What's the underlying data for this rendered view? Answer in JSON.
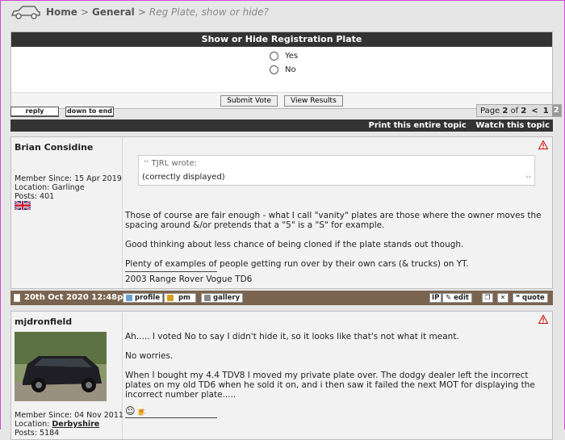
{
  "breadcrumb": {
    "home": "Home",
    "sep1": ">",
    "general": "General",
    "sep2": ">",
    "current": "Reg Plate, show or hide?"
  },
  "poll": {
    "title": "Show or Hide Registration Plate",
    "options": [
      "Yes",
      "No"
    ],
    "submit": "Submit Vote",
    "results": "View Results"
  },
  "topic_buttons": {
    "reply": "reply",
    "down": "down to end"
  },
  "pager": {
    "page": "Page",
    "current": "2",
    "of": "of",
    "total": "2",
    "prev": "<",
    "p1": "1",
    "p2": "2"
  },
  "topicbar": {
    "print": "Print this entire topic",
    "watch": "Watch this topic"
  },
  "post1": {
    "user": "Brian Considine",
    "member_since": "Member Since: 15 Apr 2019",
    "location": "Location: Garlinge",
    "posts": "Posts: 401",
    "quote_header": "TJRL wrote:",
    "quote_text": "(correctly displayed)",
    "p1": "Those of course are fair enough - what I call \"vanity\" plates are those where the owner moves the spacing around &/or pretends that a \"5\" is a \"S\" for example.",
    "p2": "Good thinking about less chance of being cloned if the plate stands out though.",
    "p3": "Plenty of examples of people getting run over by their own cars (& trucks) on YT.",
    "sig": "2003 Range Rover Vogue TD6",
    "date": "20th Oct 2020 12:48pm",
    "btn_profile": "profile",
    "btn_pm": "pm",
    "btn_gallery": "gallery",
    "btn_ip": "IP",
    "btn_edit": "edit",
    "btn_quote": "quote"
  },
  "post2": {
    "user": "mjdronfield",
    "member_since": "Member Since: 04 Nov 2011",
    "location_label": "Location:",
    "location": "Derbyshire",
    "posts": "Posts: 5184",
    "p1": "Ah..... I voted No to say I didn't hide it, so it looks like that's not what it meant.",
    "p2": "No worries.",
    "p3": "When I bought my 4.4 TDV8 I moved my private plate over. The dodgy dealer left the incorrect plates on my old TD6 when he sold it on, and i then saw it failed the next MOT for displaying the incorrect number plate....."
  },
  "colors": {
    "dark_bar": "#333333",
    "footer_bar": "#7a6450",
    "warning": "#cc0000"
  }
}
